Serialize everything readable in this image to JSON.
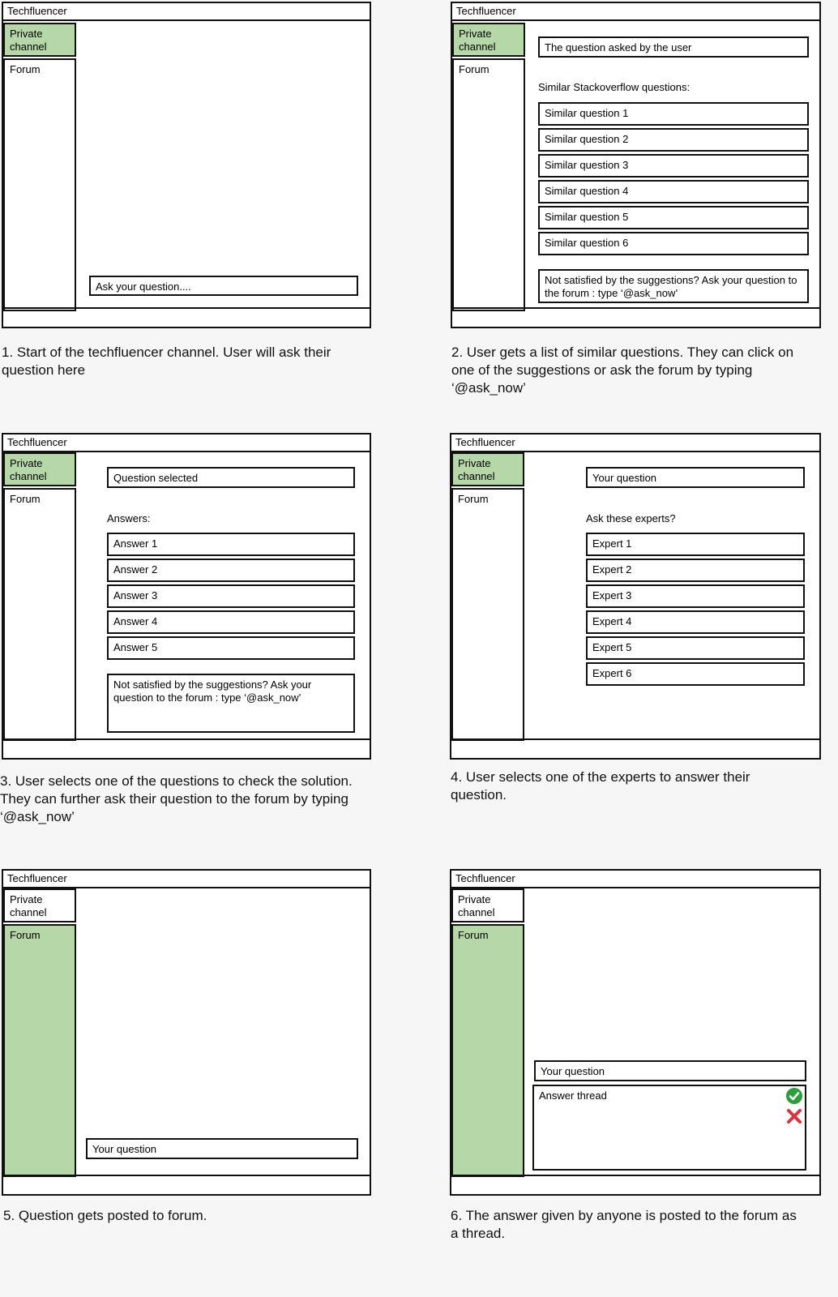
{
  "colors": {
    "active_tab": "#b6d7a8",
    "check": "#2e9e3a",
    "cross": "#d9343a"
  },
  "icons": {
    "accept": "check-circle-icon",
    "reject": "cross-icon"
  },
  "app_title": "Techfluencer",
  "sidebar": {
    "private_channel": "Private channel",
    "forum": "Forum"
  },
  "panel1": {
    "input_placeholder": "Ask your question....",
    "caption": "1. Start of the techfluencer channel. User will ask their question here"
  },
  "panel2": {
    "question_label": "The question asked by the user",
    "section_label": "Similar Stackoverflow questions:",
    "items": [
      "Similar question 1",
      "Similar question 2",
      "Similar question 3",
      "Similar question 4",
      "Similar question 5",
      "Similar question 6"
    ],
    "note": "Not satisfied by the suggestions? Ask your question to the forum : type ‘@ask_now’",
    "caption": "2. User gets a list of similar questions. They can click on one of the suggestions or ask the forum by typing ‘@ask_now’"
  },
  "panel3": {
    "question_label": "Question selected",
    "section_label": "Answers:",
    "items": [
      "Answer 1",
      "Answer 2",
      "Answer 3",
      "Answer 4",
      "Answer 5"
    ],
    "note": "Not satisfied by the suggestions? Ask your question to the forum : type ‘@ask_now’",
    "caption": "3. User selects one of the questions to check the solution. They can further ask their question to the forum by typing ‘@ask_now’"
  },
  "panel4": {
    "question_label": "Your question",
    "section_label": "Ask these experts?",
    "items": [
      "Expert 1",
      "Expert 2",
      "Expert 3",
      "Expert 4",
      "Expert 5",
      "Expert 6"
    ],
    "caption": "4. User selects one of the experts to answer their question."
  },
  "panel5": {
    "question_label": "Your question",
    "caption": "5. Question gets posted to forum."
  },
  "panel6": {
    "question_label": "Your question",
    "thread_label": "Answer thread",
    "caption": "6. The answer given by anyone is posted to the forum as a thread."
  }
}
